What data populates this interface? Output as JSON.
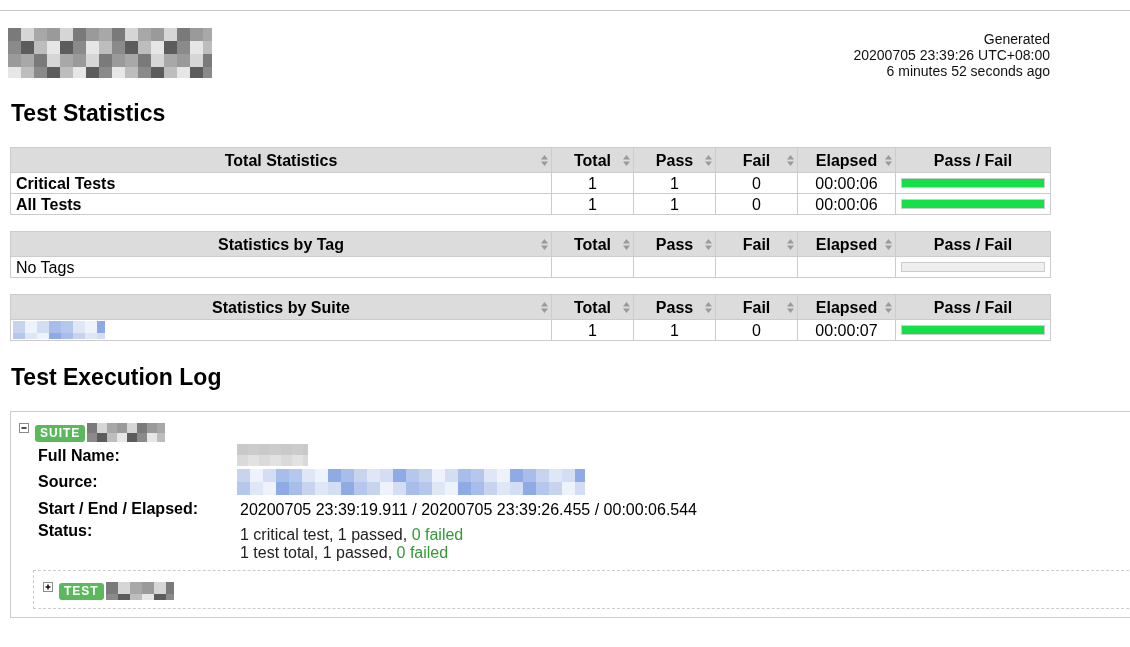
{
  "header": {
    "generated": [
      "Generated",
      "20200705 23:39:26 UTC+08:00",
      "6 minutes 52 seconds ago"
    ]
  },
  "statistics": {
    "title": "Test Statistics",
    "tables": [
      {
        "columns": [
          {
            "label": "Total Statistics",
            "sortable": true
          },
          {
            "label": "Total",
            "sortable": true
          },
          {
            "label": "Pass",
            "sortable": true
          },
          {
            "label": "Fail",
            "sortable": true
          },
          {
            "label": "Elapsed",
            "sortable": true
          },
          {
            "label": "Pass / Fail",
            "sortable": false
          }
        ],
        "rows": [
          {
            "kind": "total",
            "name": "Critical Tests",
            "total": "1",
            "pass": "1",
            "fail": "0",
            "elapsed": "00:00:06",
            "level": 1
          },
          {
            "kind": "total",
            "name": "All Tests",
            "total": "1",
            "pass": "1",
            "fail": "0",
            "elapsed": "00:00:06",
            "level": 1
          }
        ]
      },
      {
        "columns": [
          {
            "label": "Statistics by Tag",
            "sortable": true
          },
          {
            "label": "Total",
            "sortable": true
          },
          {
            "label": "Pass",
            "sortable": true
          },
          {
            "label": "Fail",
            "sortable": true
          },
          {
            "label": "Elapsed",
            "sortable": true
          },
          {
            "label": "Pass / Fail",
            "sortable": false
          }
        ],
        "rows": [
          {
            "kind": "tag",
            "name": "No Tags"
          }
        ]
      },
      {
        "columns": [
          {
            "label": "Statistics by Suite",
            "sortable": true
          },
          {
            "label": "Total",
            "sortable": true
          },
          {
            "label": "Pass",
            "sortable": true
          },
          {
            "label": "Fail",
            "sortable": true
          },
          {
            "label": "Elapsed",
            "sortable": true
          },
          {
            "label": "Pass / Fail",
            "sortable": false
          }
        ],
        "rows": [
          {
            "kind": "suite",
            "total": "1",
            "pass": "1",
            "fail": "0",
            "elapsed": "00:00:07",
            "level": 1
          }
        ]
      }
    ]
  },
  "log": {
    "title": "Test Execution Log",
    "suite": {
      "badge": "SUITE",
      "expanded": true,
      "metadata": [
        {
          "kind": "redacted",
          "label": "Full Name:"
        },
        {
          "kind": "redacted-link",
          "label": "Source:"
        },
        {
          "kind": "text",
          "label": "Start / End / Elapsed:",
          "value": "20200705 23:39:19.911 / 20200705 23:39:26.455 / 00:00:06.544"
        },
        {
          "kind": "status",
          "label": "Status:",
          "lines": [
            {
              "text": "1 critical test, 1 passed,",
              "failed": "0 failed",
              "no_failures": true
            },
            {
              "text": "1 test total, 1 passed,",
              "failed": "0 failed",
              "no_failures": true
            }
          ]
        }
      ],
      "children": [
        {
          "badge": "TEST",
          "expanded": false
        }
      ]
    }
  }
}
